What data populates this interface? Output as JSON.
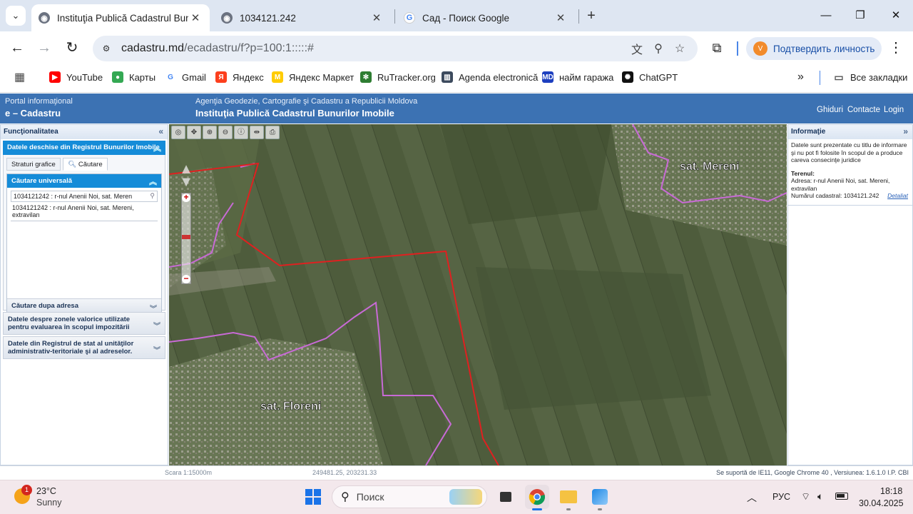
{
  "browser": {
    "tabs": [
      {
        "title": "Instituţia Publică Cadastrul Bunuril",
        "active": true
      },
      {
        "title": "1034121.242",
        "active": false
      },
      {
        "title": "Сад - Поиск Google",
        "active": false
      }
    ],
    "new_tab_label": "+",
    "url_host": "cadastru.md",
    "url_path": "/ecadastru/f?p=100:1:::::#",
    "profile_label": "Подтвердить личность",
    "profile_initial": "V",
    "bookmarks": [
      {
        "label": "YouTube",
        "icon": "youtube-icon",
        "color": "#ff0000"
      },
      {
        "label": "Карты",
        "icon": "maps-pin-icon",
        "color": "#34a853"
      },
      {
        "label": "Gmail",
        "icon": "google-g-icon",
        "color": "#4285f4"
      },
      {
        "label": "Яндекс",
        "icon": "yandex-icon",
        "color": "#fc3f1d"
      },
      {
        "label": "Яндекс Маркет",
        "icon": "yandex-market-icon",
        "color": "#ffcc00"
      },
      {
        "label": "RuTracker.org",
        "icon": "rutracker-icon",
        "color": "#2e7d32"
      },
      {
        "label": "Agenda electronică",
        "icon": "building-icon",
        "color": "#3c4a5d"
      },
      {
        "label": "найм гаража",
        "icon": "md-icon",
        "color": "#1d3fbf"
      },
      {
        "label": "ChatGPT",
        "icon": "chatgpt-icon",
        "color": "#111111"
      }
    ],
    "all_bookmarks_label": "Все закладки"
  },
  "site": {
    "portal_line1": "Portal informaţional",
    "portal_line2": "e – Cadastru",
    "agency_line1": "Agenţia Geodezie, Cartografie şi Cadastru a Republicii Moldova",
    "agency_line2": "Instituţia Publică Cadastrul Bunurilor Imobile",
    "links": [
      "Ghiduri",
      "Contacte",
      "Login"
    ]
  },
  "left_panel": {
    "title": "Funcţionalitatea",
    "section_open": "Datele deschise din Registrul Bunurilor Imobile",
    "tabs": [
      "Straturi grafice",
      "Căutare"
    ],
    "universal_search_title": "Căutare universală",
    "search_value": "1034121242 : r-nul Anenii Noi, sat. Meren",
    "result_text": "1034121242 : r-nul Anenii Noi, sat. Mereni, extravilan",
    "address_search_title": "Căutare dupa adresa",
    "section2": "Datele despre zonele valorice utilizate pentru evaluarea în scopul impozitării",
    "section3": "Datele din Registrul de stat al unităţilor administrativ-teritoriale şi al adreselor."
  },
  "map": {
    "labels": [
      "sat. Mereni",
      "sat. Floreni"
    ],
    "boundary_color": "#e02020",
    "territory_color": "#c86ad6"
  },
  "right_panel": {
    "title": "Informaţie",
    "disclaimer": "Datele sunt prezentate cu titlu de informare şi nu pot fi folosite în scopul de a produce careva consecinţe juridice",
    "terrain_label": "Terenul:",
    "address": "Adresa: r-nul Anenii Noi, sat. Mereni, extravilan",
    "cadastral_number": "Numărul cadastral: 1034121.242",
    "details_link": "Detaliat"
  },
  "status_bar": {
    "scale": "Scara 1:15000m",
    "coords": "249481.25, 203231.33",
    "support": "Se suportă de IE11, Google Chrome 40 , Versiunea: 1.6.1.0 I.P. CBI"
  },
  "taskbar": {
    "weather_temp": "23°C",
    "weather_desc": "Sunny",
    "weather_badge": "1",
    "search_placeholder": "Поиск",
    "language": "РУС",
    "time": "18:18",
    "date": "30.04.2025"
  }
}
